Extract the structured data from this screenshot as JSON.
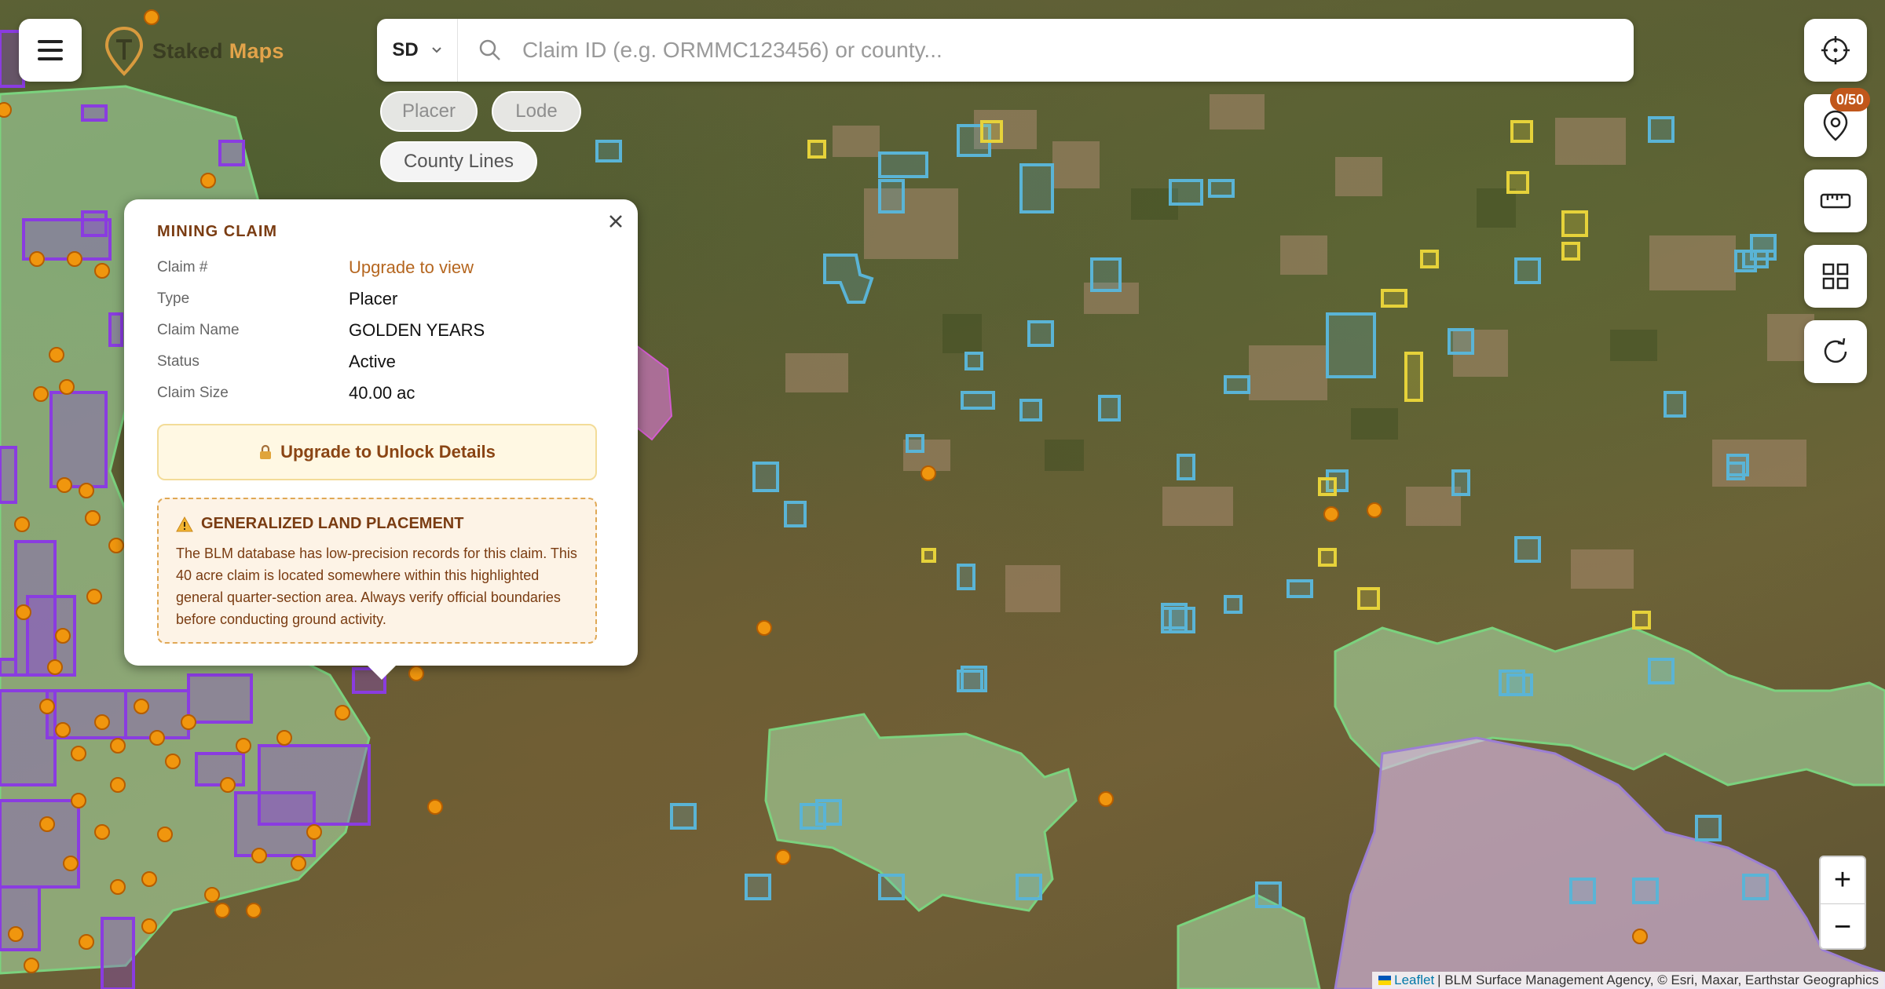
{
  "header": {
    "brand_part1": "Staked",
    "brand_part2": "Maps"
  },
  "search": {
    "state": "SD",
    "placeholder": "Claim ID (e.g. ORMMC123456) or county..."
  },
  "filters": {
    "placer_label": "Placer",
    "lode_label": "Lode",
    "county_lines_label": "County Lines"
  },
  "controls": {
    "pins_badge": "0/50",
    "icons": [
      "crosshair-icon",
      "map-pin-icon",
      "ruler-icon",
      "grid-icon",
      "refresh-icon"
    ]
  },
  "zoom": {
    "in_label": "+",
    "out_label": "−"
  },
  "attribution": {
    "link": "Leaflet",
    "text": "| BLM Surface Management Agency, © Esri, Maxar, Earthstar Geographics"
  },
  "popup": {
    "title": "MINING CLAIM",
    "fields": [
      {
        "label": "Claim #",
        "value": "Upgrade to view"
      },
      {
        "label": "Type",
        "value": "Placer"
      },
      {
        "label": "Claim Name",
        "value": "GOLDEN YEARS"
      },
      {
        "label": "Status",
        "value": "Active"
      },
      {
        "label": "Claim Size",
        "value": "40.00 ac"
      }
    ],
    "unlock_label": "Upgrade to Unlock Details",
    "warning_title": "GENERALIZED LAND PLACEMENT",
    "warning_text": "The BLM database has low-precision records for this claim. This 40 acre claim is located somewhere within this highlighted general quarter-section area. Always verify official boundaries before conducting ground activity."
  },
  "colors": {
    "accent": "#b5661f",
    "brand_gold": "#e2a34a",
    "claim_blue": "#5ab4d6",
    "claim_purple": "#8a3ce0",
    "claim_yellow": "#e6d23a",
    "claim_orange": "#f0960e",
    "blm_green": "#9fd39a",
    "forest_pink": "#d9b9e3",
    "badge": "#c1571b"
  }
}
